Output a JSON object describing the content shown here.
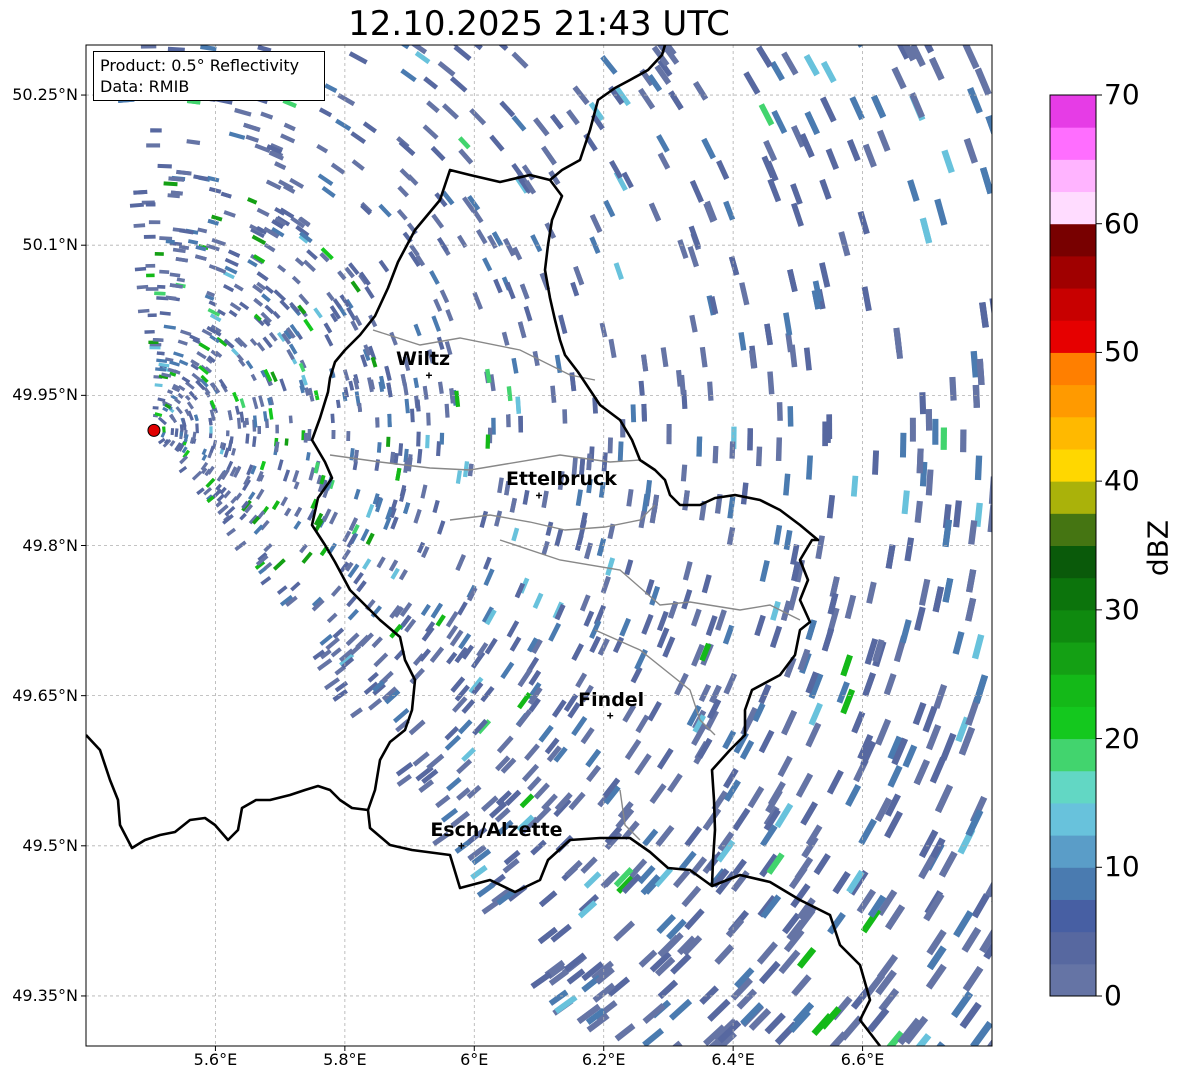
{
  "title": "12.10.2025 21:43 UTC",
  "info_box": {
    "product": "Product: 0.5° Reflectivity",
    "data": "Data: RMIB"
  },
  "map": {
    "lon_range": [
      5.4,
      6.8
    ],
    "lat_range": [
      49.3,
      50.3
    ],
    "lat_ticks": [
      {
        "value": 50.25,
        "label": "50.25°N"
      },
      {
        "value": 50.1,
        "label": "50.1°N"
      },
      {
        "value": 49.95,
        "label": "49.95°N"
      },
      {
        "value": 49.8,
        "label": "49.8°N"
      },
      {
        "value": 49.65,
        "label": "49.65°N"
      },
      {
        "value": 49.5,
        "label": "49.5°N"
      },
      {
        "value": 49.35,
        "label": "49.35°N"
      }
    ],
    "lon_ticks": [
      {
        "value": 5.6,
        "label": "5.6°E"
      },
      {
        "value": 5.8,
        "label": "5.8°E"
      },
      {
        "value": 6.0,
        "label": "6°E"
      },
      {
        "value": 6.2,
        "label": "6.2°E"
      },
      {
        "value": 6.4,
        "label": "6.4°E"
      },
      {
        "value": 6.6,
        "label": "6.6°E"
      }
    ],
    "radar_site": {
      "lon": 5.505,
      "lat": 49.915
    },
    "cities": [
      {
        "name": "Wiltz",
        "lon": 5.93,
        "lat": 49.97
      },
      {
        "name": "Ettelbruck",
        "lon": 6.1,
        "lat": 49.85
      },
      {
        "name": "Findel",
        "lon": 6.21,
        "lat": 49.63
      },
      {
        "name": "Esch/Alzette",
        "lon": 5.98,
        "lat": 49.5
      }
    ]
  },
  "colorbar": {
    "label": "dBZ",
    "min": 0,
    "max": 70,
    "ticks": [
      {
        "value": 0,
        "label": "0"
      },
      {
        "value": 10,
        "label": "10"
      },
      {
        "value": 20,
        "label": "20"
      },
      {
        "value": 30,
        "label": "30"
      },
      {
        "value": 40,
        "label": "40"
      },
      {
        "value": 50,
        "label": "50"
      },
      {
        "value": 60,
        "label": "60"
      },
      {
        "value": 70,
        "label": "70"
      }
    ],
    "colors": [
      "#6574a5",
      "#5768a0",
      "#475fa3",
      "#4a7bb0",
      "#5a9dc8",
      "#68c2dc",
      "#62d7c4",
      "#42d46e",
      "#14c81e",
      "#14b918",
      "#14a014",
      "#0f8a0f",
      "#0c740c",
      "#0a5a0a",
      "#457512",
      "#aab20a",
      "#ffd700",
      "#ffb900",
      "#ff9a00",
      "#ff7f00",
      "#e60000",
      "#c80000",
      "#a00000",
      "#780000",
      "#ffdcff",
      "#ffb4ff",
      "#ff6eff",
      "#e63ce6"
    ]
  }
}
